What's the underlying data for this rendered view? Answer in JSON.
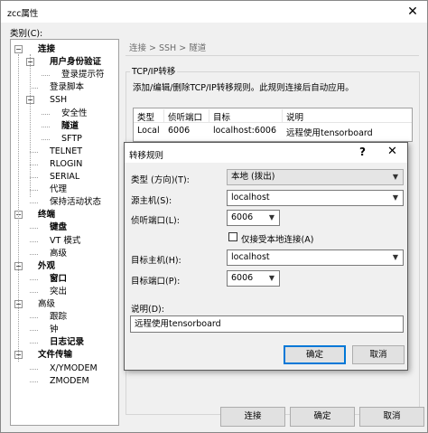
{
  "window": {
    "title": "zcc属性",
    "close_glyph": "✕"
  },
  "category_label": "类别(C):",
  "tree": [
    {
      "label": "连接",
      "bold": true,
      "box": "−"
    },
    {
      "label": "用户身份验证",
      "bold": true,
      "box": "−"
    },
    {
      "label": "登录提示符",
      "bold": false
    },
    {
      "label": "登录脚本",
      "bold": false
    },
    {
      "label": "SSH",
      "bold": false,
      "box": "−"
    },
    {
      "label": "安全性",
      "bold": false
    },
    {
      "label": "隧道",
      "bold": true
    },
    {
      "label": "SFTP",
      "bold": false
    },
    {
      "label": "TELNET",
      "bold": false
    },
    {
      "label": "RLOGIN",
      "bold": false
    },
    {
      "label": "SERIAL",
      "bold": false
    },
    {
      "label": "代理",
      "bold": false
    },
    {
      "label": "保持活动状态",
      "bold": false
    },
    {
      "label": "终端",
      "bold": true,
      "box": "−"
    },
    {
      "label": "键盘",
      "bold": true
    },
    {
      "label": "VT 模式",
      "bold": false
    },
    {
      "label": "高级",
      "bold": false
    },
    {
      "label": "外观",
      "bold": true,
      "box": "−"
    },
    {
      "label": "窗口",
      "bold": true
    },
    {
      "label": "突出",
      "bold": false
    },
    {
      "label": "高级",
      "bold": false,
      "box": "−"
    },
    {
      "label": "跟踪",
      "bold": false
    },
    {
      "label": "钟",
      "bold": false
    },
    {
      "label": "日志记录",
      "bold": true
    },
    {
      "label": "文件传输",
      "bold": true,
      "box": "−"
    },
    {
      "label": "X/YMODEM",
      "bold": false
    },
    {
      "label": "ZMODEM",
      "bold": false
    }
  ],
  "breadcrumb": "连接 > SSH > 隧道",
  "group_title": "TCP/IP转移",
  "description": "添加/编辑/删除TCP/IP转移规则。此规则连接后自动应用。",
  "table": {
    "headers": [
      "类型",
      "侦听端口",
      "目标",
      "说明"
    ],
    "rows": [
      [
        "Local",
        "6006",
        "localhost:6006",
        "远程使用tensorboard"
      ]
    ]
  },
  "buttons": {
    "connect": "连接",
    "ok": "确定",
    "cancel": "取消"
  },
  "dialog": {
    "title": "转移规则",
    "help_glyph": "?",
    "close_glyph": "✕",
    "type_label": "类型 (方向)(T):",
    "type_value": "本地 (拨出)",
    "source_host_label": "源主机(S):",
    "source_host_value": "localhost",
    "listen_port_label": "侦听端口(L):",
    "listen_port_value": "6006",
    "local_only_label": "仅接受本地连接(A)",
    "target_host_label": "目标主机(H):",
    "target_host_value": "localhost",
    "target_port_label": "目标端口(P):",
    "target_port_value": "6006",
    "desc_label": "说明(D):",
    "desc_value": "远程使用tensorboard",
    "ok": "确定",
    "cancel": "取消"
  },
  "colors": {
    "accent": "#0078d7",
    "window_bg": "#f0f0f0"
  }
}
